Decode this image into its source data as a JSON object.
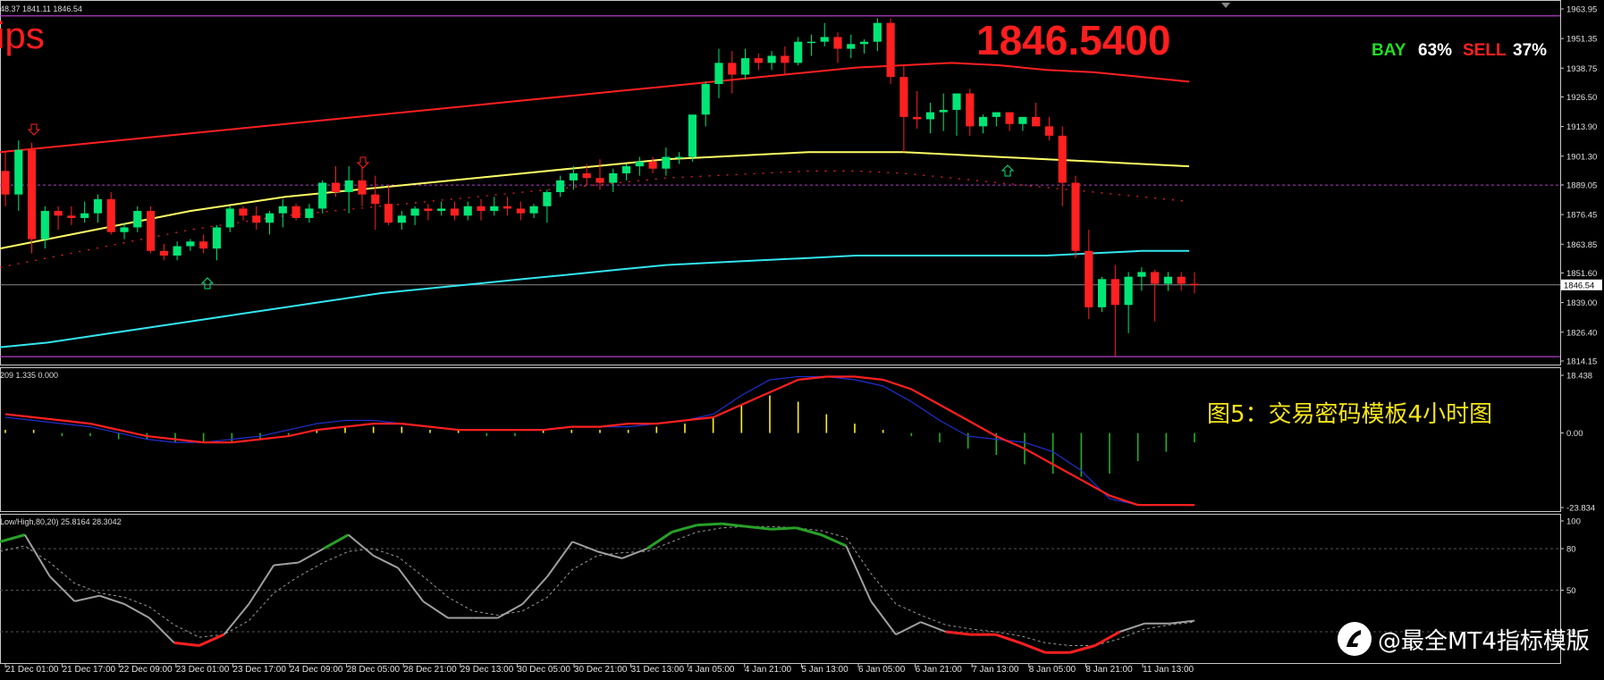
{
  "header": {
    "main_info": "48.37 1841.11 1846.54",
    "macd_info": "209 1.335 0.000",
    "stoch_info": "Low/High,80,20) 25.8164 28.3042"
  },
  "overlay": {
    "brand_text": "ips",
    "current_price": "1846.5400",
    "bay_label": "BAY",
    "bay_pct": "63%",
    "sell_label": "SELL",
    "sell_pct": "37%",
    "caption": "图5：交易密码模板4小时图",
    "watermark": "@最全MT4指标模版"
  },
  "price_axis": {
    "ticks": [
      "1963.95",
      "1951.35",
      "1938.75",
      "1926.50",
      "1913.90",
      "1901.30",
      "1889.05",
      "1876.45",
      "1863.85",
      "1851.60",
      "1839.00",
      "1826.40",
      "1814.15"
    ],
    "current_tag": "1846.54"
  },
  "macd_axis": {
    "ticks": [
      "18.438",
      "0.00",
      "-23.834"
    ]
  },
  "stoch_axis": {
    "ticks": [
      "100",
      "80",
      "50",
      "20"
    ]
  },
  "time_axis": {
    "labels": [
      "21 Dec 01:00",
      "21 Dec 17:00",
      "22 Dec 09:00",
      "23 Dec 01:00",
      "23 Dec 17:00",
      "24 Dec 09:00",
      "28 Dec 05:00",
      "28 Dec 21:00",
      "29 Dec 13:00",
      "30 Dec 05:00",
      "30 Dec 21:00",
      "31 Dec 13:00",
      "4 Jan 05:00",
      "4 Jan 21:00",
      "5 Jan 13:00",
      "6 Jan 05:00",
      "6 Jan 21:00",
      "7 Jan 13:00",
      "8 Jan 05:00",
      "8 Jan 21:00",
      "11 Jan 13:00"
    ]
  },
  "colors": {
    "bull": "#00e676",
    "bear": "#ff2020",
    "upper_band": "#ff2020",
    "middle_band": "#ffff66",
    "lower_band": "#33e6f0",
    "channel": "#b040c8",
    "macd_main": "#ff2020",
    "macd_signal": "#2030d0",
    "stoch_main": "#a0a0a0",
    "bay": "#22dd22",
    "sell": "#ff2020"
  },
  "chart_data": {
    "type": "candlestick",
    "symbol_timeframe": "H4",
    "ylim": [
      1814.15,
      1963.95
    ],
    "candles": [
      [
        1895,
        1903,
        1880,
        1885
      ],
      [
        1885,
        1908,
        1878,
        1904
      ],
      [
        1904,
        1907,
        1860,
        1866
      ],
      [
        1866,
        1880,
        1862,
        1878
      ],
      [
        1878,
        1880,
        1870,
        1876
      ],
      [
        1876,
        1880,
        1872,
        1875
      ],
      [
        1875,
        1882,
        1873,
        1877
      ],
      [
        1877,
        1885,
        1873,
        1883
      ],
      [
        1883,
        1886,
        1868,
        1869
      ],
      [
        1869,
        1873,
        1866,
        1871
      ],
      [
        1871,
        1880,
        1869,
        1878
      ],
      [
        1878,
        1880,
        1860,
        1861
      ],
      [
        1861,
        1864,
        1857,
        1859
      ],
      [
        1859,
        1865,
        1857,
        1863
      ],
      [
        1863,
        1866,
        1861,
        1865
      ],
      [
        1865,
        1868,
        1860,
        1862
      ],
      [
        1862,
        1872,
        1857,
        1871
      ],
      [
        1871,
        1880,
        1869,
        1879
      ],
      [
        1879,
        1880,
        1874,
        1876
      ],
      [
        1876,
        1880,
        1870,
        1873
      ],
      [
        1873,
        1878,
        1868,
        1877
      ],
      [
        1877,
        1883,
        1871,
        1880
      ],
      [
        1880,
        1881,
        1874,
        1875
      ],
      [
        1875,
        1881,
        1873,
        1879
      ],
      [
        1879,
        1891,
        1877,
        1890
      ],
      [
        1890,
        1897,
        1884,
        1886
      ],
      [
        1886,
        1897,
        1877,
        1891
      ],
      [
        1891,
        1897,
        1880,
        1885
      ],
      [
        1885,
        1893,
        1870,
        1881
      ],
      [
        1881,
        1889,
        1872,
        1873
      ],
      [
        1873,
        1878,
        1870,
        1876
      ],
      [
        1876,
        1880,
        1872,
        1879
      ],
      [
        1879,
        1881,
        1874,
        1878
      ],
      [
        1878,
        1882,
        1876,
        1879
      ],
      [
        1879,
        1882,
        1874,
        1876
      ],
      [
        1876,
        1882,
        1874,
        1880
      ],
      [
        1880,
        1883,
        1874,
        1878
      ],
      [
        1878,
        1884,
        1876,
        1880
      ],
      [
        1880,
        1884,
        1876,
        1879
      ],
      [
        1879,
        1882,
        1874,
        1877
      ],
      [
        1877,
        1881,
        1875,
        1880
      ],
      [
        1880,
        1887,
        1873,
        1886
      ],
      [
        1886,
        1893,
        1884,
        1891
      ],
      [
        1891,
        1897,
        1887,
        1894
      ],
      [
        1894,
        1898,
        1889,
        1892
      ],
      [
        1892,
        1900,
        1887,
        1890
      ],
      [
        1890,
        1896,
        1886,
        1894
      ],
      [
        1894,
        1898,
        1891,
        1897
      ],
      [
        1897,
        1901,
        1893,
        1899
      ],
      [
        1899,
        1901,
        1894,
        1896
      ],
      [
        1896,
        1905,
        1893,
        1901
      ],
      [
        1901,
        1903,
        1898,
        1901
      ],
      [
        1901,
        1918,
        1899,
        1919
      ],
      [
        1919,
        1933,
        1914,
        1932
      ],
      [
        1932,
        1947,
        1926,
        1941
      ],
      [
        1941,
        1946,
        1928,
        1936
      ],
      [
        1936,
        1947,
        1934,
        1943
      ],
      [
        1943,
        1945,
        1938,
        1941
      ],
      [
        1941,
        1946,
        1938,
        1944
      ],
      [
        1944,
        1948,
        1936,
        1941
      ],
      [
        1941,
        1952,
        1940,
        1950
      ],
      [
        1950,
        1953,
        1944,
        1950
      ],
      [
        1950,
        1958,
        1948,
        1952
      ],
      [
        1952,
        1954,
        1941,
        1947
      ],
      [
        1947,
        1953,
        1943,
        1949
      ],
      [
        1949,
        1951,
        1945,
        1950
      ],
      [
        1950,
        1960,
        1946,
        1958
      ],
      [
        1958,
        1960,
        1932,
        1935
      ],
      [
        1935,
        1940,
        1903,
        1918
      ],
      [
        1918,
        1929,
        1913,
        1917
      ],
      [
        1917,
        1924,
        1911,
        1920
      ],
      [
        1920,
        1928,
        1912,
        1921
      ],
      [
        1921,
        1926,
        1910,
        1928
      ],
      [
        1928,
        1930,
        1910,
        1914
      ],
      [
        1914,
        1919,
        1911,
        1918
      ],
      [
        1918,
        1920,
        1914,
        1920
      ],
      [
        1920,
        1920,
        1912,
        1915
      ],
      [
        1915,
        1917,
        1912,
        1918
      ],
      [
        1918,
        1924,
        1916,
        1914
      ],
      [
        1914,
        1918,
        1908,
        1910
      ],
      [
        1910,
        1914,
        1880,
        1890
      ],
      [
        1890,
        1893,
        1858,
        1861
      ],
      [
        1861,
        1870,
        1832,
        1837
      ],
      [
        1837,
        1850,
        1835,
        1849
      ],
      [
        1849,
        1855,
        1816,
        1838
      ],
      [
        1838,
        1852,
        1826,
        1850
      ],
      [
        1850,
        1854,
        1844,
        1852
      ],
      [
        1852,
        1853,
        1831,
        1847
      ],
      [
        1847,
        1852,
        1844,
        1850
      ],
      [
        1850,
        1852,
        1844,
        1847
      ],
      [
        1847,
        1852,
        1843,
        1846.54
      ]
    ],
    "upper_band": [
      1903,
      1905,
      1907,
      1909,
      1911,
      1913,
      1915,
      1917,
      1919,
      1921,
      1923,
      1925,
      1927,
      1929,
      1931,
      1933,
      1935,
      1937,
      1939,
      1940,
      1941,
      1940,
      1938,
      1937,
      1935,
      1933
    ],
    "middle_band": [
      1862,
      1866,
      1870,
      1874,
      1878,
      1881,
      1884,
      1886,
      1888,
      1890,
      1892,
      1894,
      1896,
      1898,
      1900,
      1901,
      1902,
      1903,
      1903,
      1903,
      1902,
      1901,
      1900,
      1899,
      1898,
      1897
    ],
    "lower_band": [
      1820,
      1822,
      1825,
      1828,
      1831,
      1834,
      1837,
      1840,
      1843,
      1845,
      1847,
      1849,
      1851,
      1853,
      1855,
      1856,
      1857,
      1858,
      1859,
      1859,
      1859,
      1859,
      1859,
      1860,
      1861,
      1861
    ],
    "channel_top": 1961,
    "channel_bottom": 1816,
    "level_line": 1889,
    "current_line": 1846.54,
    "macd": {
      "ylim": [
        -23.834,
        18.438
      ],
      "main": [
        6,
        5,
        4,
        3,
        1,
        -1,
        -2,
        -3,
        -3,
        -2,
        -1,
        1,
        2,
        3,
        3,
        2,
        1,
        1,
        1,
        1,
        2,
        2,
        3,
        3,
        4,
        5,
        9,
        13,
        17,
        18,
        18,
        17,
        14,
        9,
        4,
        -1,
        -5,
        -10,
        -15,
        -20,
        -23,
        -23,
        -23
      ],
      "signal": [
        5,
        4,
        3,
        2,
        0,
        -2,
        -3,
        -3,
        -2,
        -1,
        1,
        3,
        4,
        4,
        3,
        2,
        1,
        1,
        1,
        1,
        2,
        2,
        2,
        3,
        4,
        6,
        12,
        17,
        18,
        18,
        17,
        15,
        10,
        4,
        -1,
        -2,
        -3,
        -6,
        -12,
        -21,
        -23,
        -23,
        -23
      ],
      "histogram": [
        1,
        1,
        -1,
        -1,
        -2,
        -2,
        -3,
        -3,
        -3,
        -2,
        -1,
        1,
        2,
        2,
        2,
        1,
        1,
        -1,
        -1,
        1,
        1,
        1,
        1,
        2,
        3,
        5,
        9,
        12,
        10,
        6,
        3,
        1,
        -1,
        -3,
        -5,
        -7,
        -10,
        -13,
        -14,
        -13,
        -9,
        -6,
        -3
      ]
    },
    "stochastic": {
      "ylim": [
        0,
        100
      ],
      "levels": [
        80,
        50,
        20
      ],
      "main": [
        85,
        90,
        60,
        42,
        46,
        40,
        30,
        12,
        10,
        18,
        40,
        68,
        70,
        80,
        90,
        75,
        66,
        42,
        30,
        30,
        30,
        40,
        60,
        85,
        78,
        73,
        80,
        92,
        97,
        98,
        96,
        94,
        95,
        90,
        82,
        42,
        18,
        27,
        20,
        18,
        18,
        12,
        5,
        5,
        10,
        20,
        26,
        26,
        28
      ],
      "signal": [
        78,
        82,
        70,
        55,
        48,
        45,
        38,
        25,
        16,
        18,
        28,
        48,
        60,
        70,
        78,
        80,
        74,
        60,
        45,
        35,
        32,
        35,
        45,
        65,
        75,
        77,
        78,
        85,
        92,
        95,
        96,
        96,
        95,
        93,
        88,
        62,
        40,
        32,
        25,
        22,
        20,
        17,
        12,
        10,
        10,
        15,
        22,
        25,
        27
      ]
    }
  }
}
